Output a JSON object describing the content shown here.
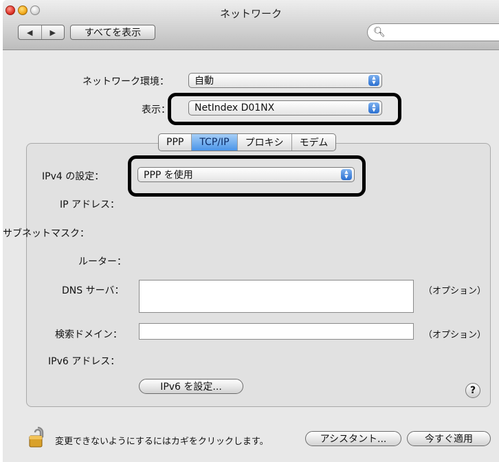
{
  "window": {
    "title": "ネットワーク"
  },
  "toolbar": {
    "back_icon": "◀",
    "forward_icon": "▶",
    "show_all": "すべてを表示",
    "search_icon": "🔍︎",
    "search_value": ""
  },
  "location": {
    "label": "ネットワーク環境：",
    "value": "自動"
  },
  "show": {
    "label": "表示：",
    "value": "NetIndex D01NX"
  },
  "tabs": [
    "PPP",
    "TCP/IP",
    "プロキシ",
    "モデム"
  ],
  "tcpip": {
    "ipv4_label": "IPv4 の設定：",
    "ipv4_value": "PPP を使用",
    "ip_label": "IP アドレス：",
    "subnet_label": "サブネットマスク：",
    "router_label": "ルーター：",
    "dns_label": "DNS サーバ：",
    "dns_value": "",
    "dns_option": "（オプション）",
    "search_domain_label": "検索ドメイン：",
    "search_domain_value": "",
    "search_domain_option": "（オプション）",
    "ipv6_label": "IPv6 アドレス：",
    "ipv6_button": "IPv6 を設定...",
    "help": "?"
  },
  "footer": {
    "lock_text": "変更できないようにするにはカギをクリックします。",
    "assistant_button": "アシスタント...",
    "apply_button": "今すぐ適用"
  },
  "colors": {
    "active_tab": "#4a94e8",
    "highlight_border": "#000000"
  }
}
